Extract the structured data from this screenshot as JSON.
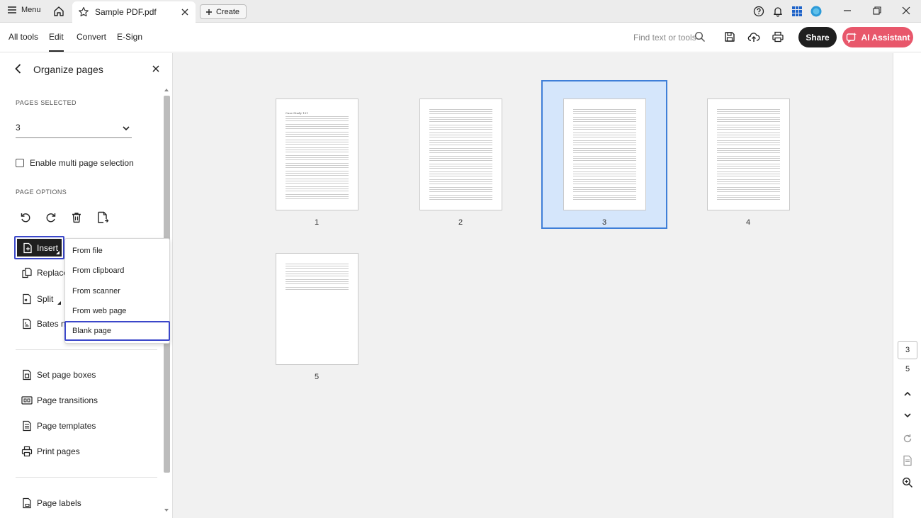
{
  "titlebar": {
    "menu_label": "Menu",
    "tab_title": "Sample PDF.pdf",
    "create_label": "Create"
  },
  "toolbar": {
    "tabs": [
      "All tools",
      "Edit",
      "Convert",
      "E-Sign"
    ],
    "active_tab": "Edit",
    "search_placeholder": "Find text or tools",
    "share_label": "Share",
    "ai_label": "AI Assistant"
  },
  "panel": {
    "title": "Organize pages",
    "pages_selected_label": "PAGES SELECTED",
    "pages_selected_value": "3",
    "multi_select_label": "Enable multi page selection",
    "page_options_label": "PAGE OPTIONS",
    "items": {
      "insert": "Insert",
      "replace": "Replace",
      "split": "Split",
      "bates": "Bates nu",
      "set_page_boxes": "Set page boxes",
      "page_transitions": "Page transitions",
      "page_templates": "Page templates",
      "print_pages": "Print pages",
      "page_labels": "Page labels"
    }
  },
  "insert_menu": {
    "items": [
      "From file",
      "From clipboard",
      "From scanner",
      "From web page",
      "Blank page"
    ],
    "focused": "Blank page"
  },
  "pages": {
    "numbers": [
      "1",
      "2",
      "3",
      "4",
      "5"
    ],
    "selected": "3",
    "page1_heading": "Case Study 101"
  },
  "rightrail": {
    "current_page": "3",
    "total_pages": "5"
  },
  "colors": {
    "accent_blue": "#3b47c9",
    "selection_fill": "#d5e6fb",
    "selection_border": "#3f7fd8",
    "ai_button": "#e8576b",
    "dark_button": "#1f1f1f"
  }
}
